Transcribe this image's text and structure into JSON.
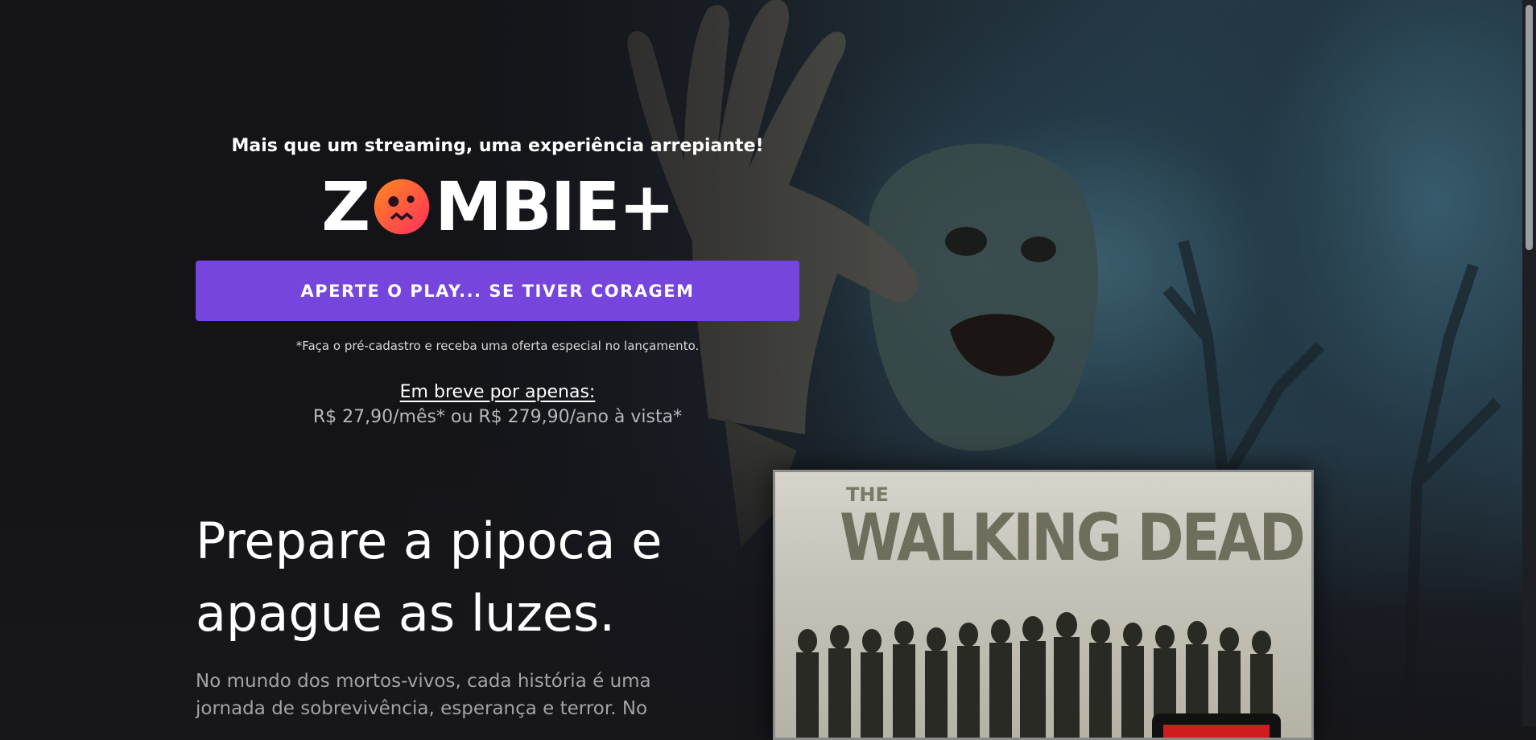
{
  "hero": {
    "tagline": "Mais que um streaming, uma experiência arrepiante!",
    "logo": {
      "part1": "Z",
      "part2": "MBIE+",
      "icon": "zombie-face-icon"
    },
    "cta_label": "APERTE O PLAY... SE TIVER CORAGEM",
    "note": "*Faça o pré-cadastro e receba uma oferta especial no lançamento.",
    "price_title": "Em breve por apenas:",
    "price_value": "R$ 27,90/mês* ou R$ 279,90/ano à vista*"
  },
  "section": {
    "title": "Prepare a pipoca e apague as luzes.",
    "text": "No mundo dos mortos-vivos, cada história é uma jornada de sobrevivência, esperança e terror. No"
  },
  "poster": {
    "the": "THE",
    "title": "WALKING DEAD"
  },
  "colors": {
    "accent": "#7545dd",
    "background": "#16161b",
    "logo_gradient_start": "#ff2d5e",
    "logo_gradient_end": "#ff8a1e"
  }
}
